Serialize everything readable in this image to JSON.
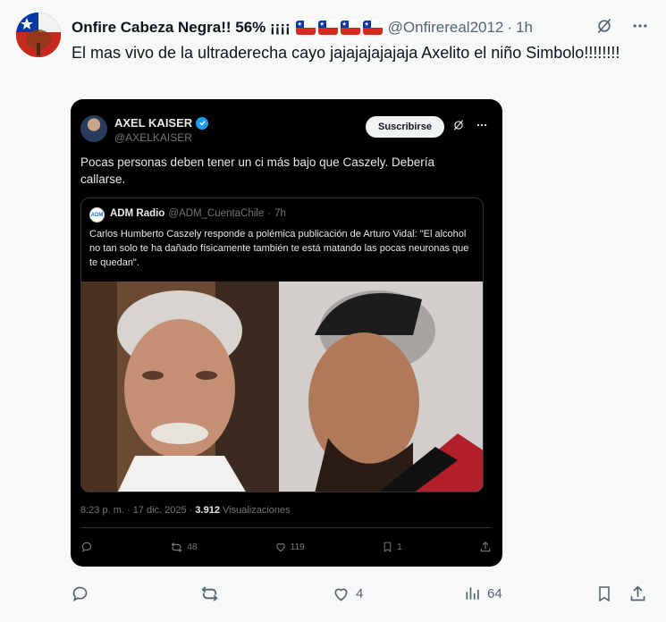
{
  "post": {
    "display_name": "Onfire Cabeza Negra!! 56% ¡¡¡¡",
    "handle": "@Onfirereal2012",
    "separator": "·",
    "time": "1h",
    "text": "El mas vivo de la ultraderecha  cayo jajajajajajaja Axelito el niño Simbolo!!!!!!!!"
  },
  "embed": {
    "name": "AXEL KAISER",
    "handle": "@AXELKAISER",
    "subscribe_label": "Suscribirse",
    "text": "Pocas personas deben tener un ci más bajo que Caszely. Debería callarse.",
    "quote": {
      "avatar_text": "ADM",
      "name": "ADM Radio",
      "handle": "@ADM_CuentaChile",
      "separator": "·",
      "time": "7h",
      "text": "Carlos Humberto Caszely responde a polémica publicación de Arturo Vidal: \"El alcohol no tan solo te ha dañado físicamente también te está matando las pocas neuronas que te quedan\"."
    },
    "meta_time": "8:23 p. m. · 17 dic. 2025 ·",
    "views_count": "3.912",
    "views_label": "Visualizaciones",
    "reposts": "48",
    "likes": "119",
    "bookmarks": "1"
  },
  "actions": {
    "likes": "4",
    "views": "64"
  },
  "colors": {
    "accent": "#1d9bf0",
    "muted": "#536471",
    "background": "#f7f9f9"
  }
}
